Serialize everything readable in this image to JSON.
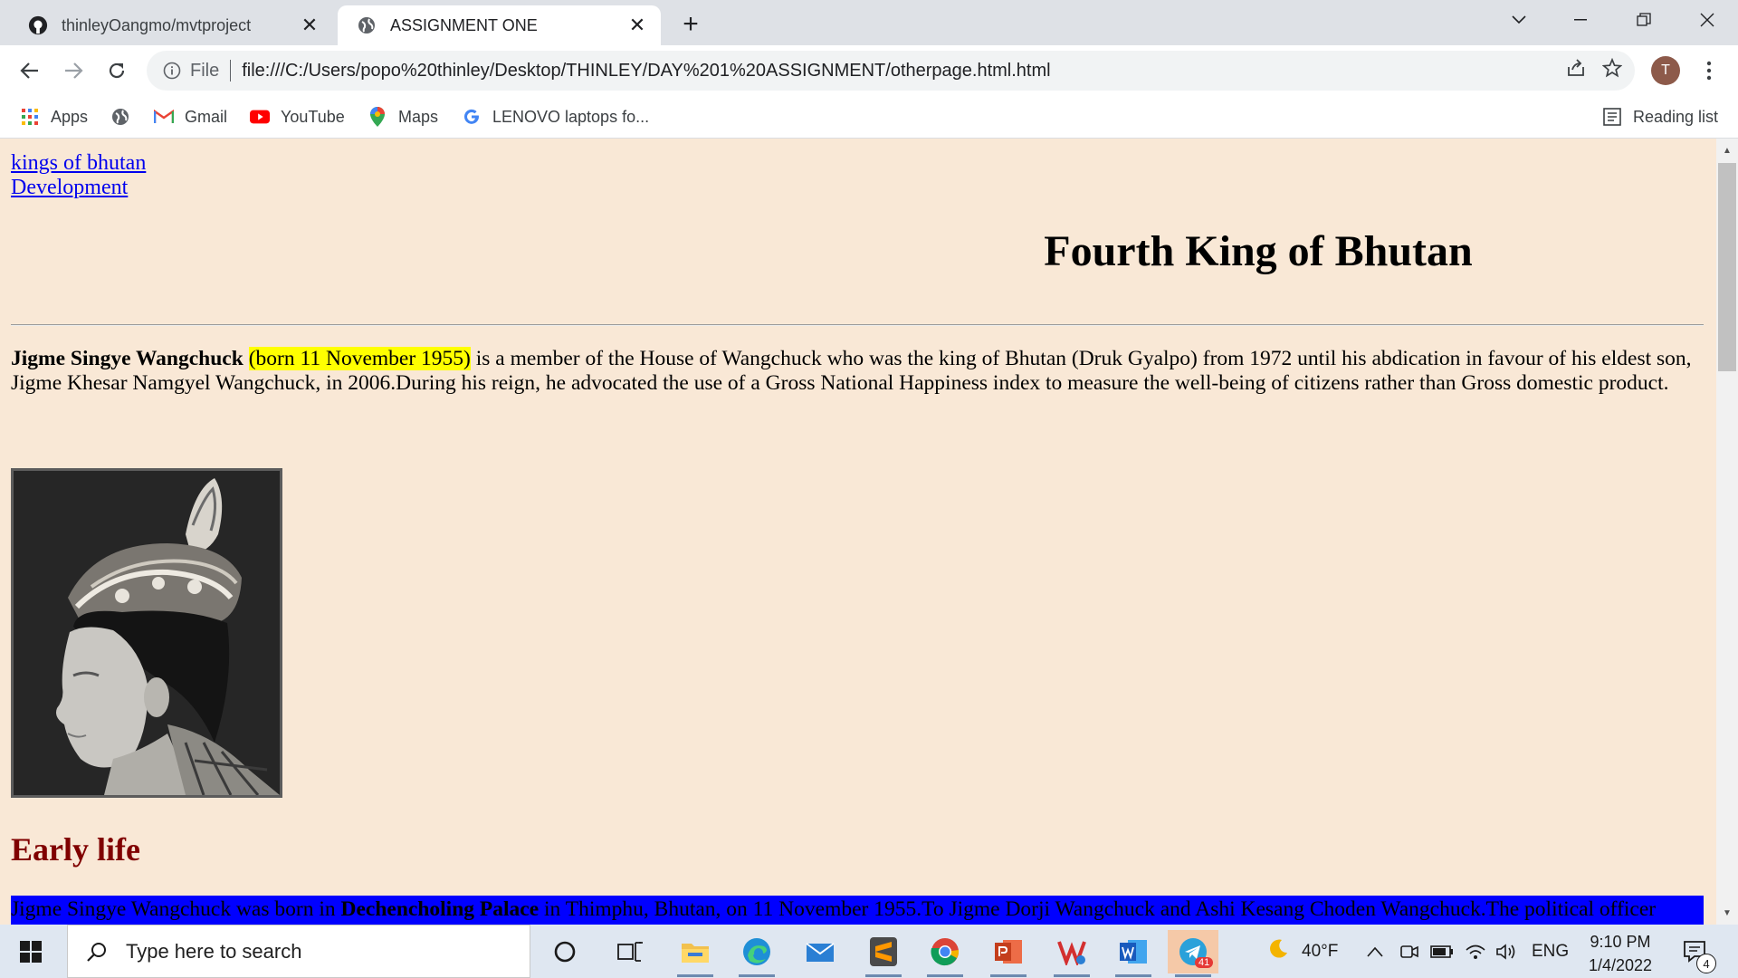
{
  "browser": {
    "tabs": [
      {
        "title": "thinleyOangmo/mvtproject",
        "icon": "github-icon",
        "active": false
      },
      {
        "title": "ASSIGNMENT ONE",
        "icon": "globe-icon",
        "active": true
      }
    ],
    "address": {
      "scheme_label": "File",
      "url": "file:///C:/Users/popo%20thinley/Desktop/THINLEY/DAY%201%20ASSIGNMENT/otherpage.html.html"
    },
    "profile_initial": "T",
    "bookmarks": [
      {
        "label": "Apps",
        "icon": "apps-grid-icon"
      },
      {
        "label": "",
        "icon": "globe-icon"
      },
      {
        "label": "Gmail",
        "icon": "gmail-icon"
      },
      {
        "label": "YouTube",
        "icon": "youtube-icon"
      },
      {
        "label": "Maps",
        "icon": "maps-pin-icon"
      },
      {
        "label": "LENOVO laptops fo...",
        "icon": "google-g-icon"
      }
    ],
    "reading_list_label": "Reading list"
  },
  "page": {
    "links": [
      "kings of bhutan",
      "Development"
    ],
    "heading": "Fourth King of Bhutan",
    "intro": {
      "name": "Jigme Singye Wangchuck",
      "born": "(born 11 November 1955)",
      "rest": " is a member of the House of Wangchuck who was the king of Bhutan (Druk Gyalpo) from 1972 until his abdication in favour of his eldest son, Jigme Khesar Namgyel Wangchuck, in 2006.During his reign, he advocated the use of a Gross National Happiness index to measure the well-being of citizens rather than Gross domestic product."
    },
    "section_heading": "Early life",
    "early_life": {
      "before": "Jigme Singye Wangchuck was born in ",
      "bold": "Dechencholing Palace",
      "after": " in Thimphu, Bhutan, on 11 November 1955.To Jigme Dorji Wangchuck and Ashi Kesang Choden Wangchuck.The political officer"
    }
  },
  "taskbar": {
    "search_placeholder": "Type here to search",
    "weather": "40°F",
    "language": "ENG",
    "time": "9:10 PM",
    "date": "1/4/2022",
    "telegram_badge": "41",
    "notification_count": "4"
  }
}
